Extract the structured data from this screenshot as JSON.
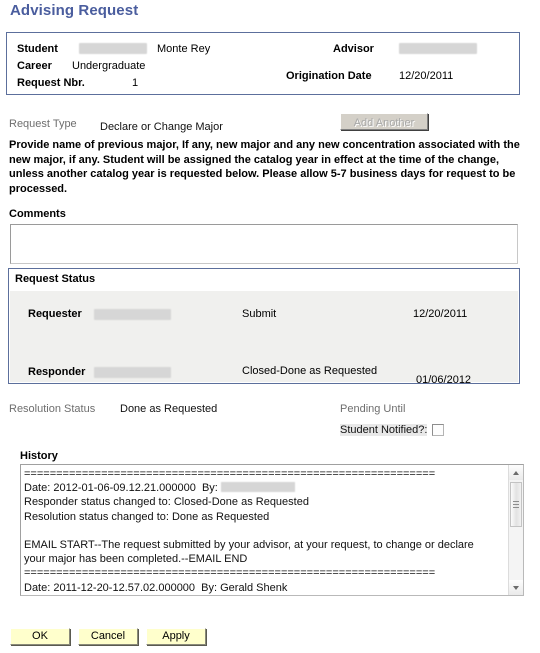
{
  "page": {
    "title": "Advising Request"
  },
  "header": {
    "student_label": "Student",
    "student_id_redacted": true,
    "student_name": "Monte Rey",
    "career_label": "Career",
    "career_value": "Undergraduate",
    "request_nbr_label": "Request Nbr.",
    "request_nbr_value": "1",
    "advisor_label": "Advisor",
    "advisor_redacted": true,
    "origination_date_label": "Origination Date",
    "origination_date_value": "12/20/2011"
  },
  "request_type": {
    "label": "Request Type",
    "value": "Declare or Change Major",
    "add_another_label": "Add Another",
    "add_another_disabled": true
  },
  "instructions": {
    "text": "Provide name of previous major, If any, new major and any new concentration associated with the new major, if any. Student will be assigned the catalog year in effect at the time of the change, unless another catalog year is requested below. Please allow 5-7 business days for request to be processed."
  },
  "comments": {
    "label": "Comments",
    "value": "",
    "placeholder": ""
  },
  "request_status": {
    "title": "Request Status",
    "rows": [
      {
        "role_label": "Requester",
        "name_redacted": true,
        "status": "Submit",
        "date": "12/20/2011"
      },
      {
        "role_label": "Responder",
        "name_redacted": true,
        "status": "Closed-Done as Requested",
        "date": "01/06/2012"
      }
    ]
  },
  "resolution": {
    "status_label": "Resolution Status",
    "status_value": "Done as Requested",
    "pending_until_label": "Pending Until",
    "pending_until_value": "",
    "student_notified_label": "Student Notified?:",
    "student_notified_checked": false
  },
  "history": {
    "label": "History",
    "line_1": "================================================================",
    "line_2_prefix": "Date: 2012-01-06-09.12.21.000000  By:",
    "line_3": "Responder status changed to: Closed-Done as Requested",
    "line_4": "Resolution status changed to: Done as Requested",
    "line_5": "",
    "line_6": "EMAIL START--The request submitted by your advisor, at your request, to change or declare your major has been completed.--EMAIL END",
    "line_7": "================================================================",
    "line_8": "Date: 2011-12-20-12.57.02.000000  By: Gerald Shenk"
  },
  "footer": {
    "ok_label": "OK",
    "cancel_label": "Cancel",
    "apply_label": "Apply"
  },
  "colors": {
    "title_blue": "#4a5d9e",
    "panel_border": "#5c6f9c",
    "button_yellow": "#ffffcc",
    "status_body_gray": "#f0f0ee"
  }
}
